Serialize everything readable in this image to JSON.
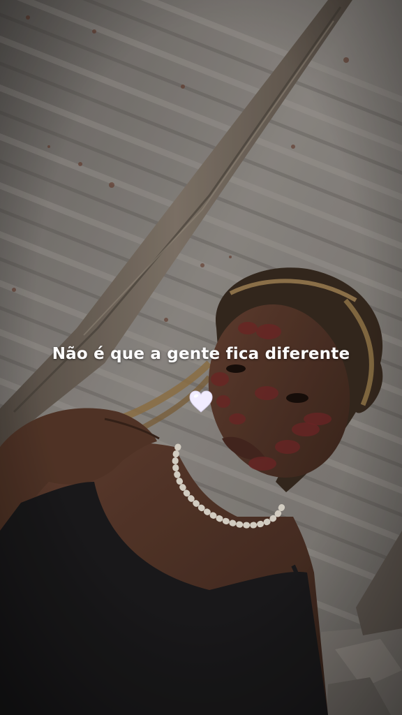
{
  "caption": {
    "text": "Não é que a gente fica diferente",
    "emoji": "white-heart"
  },
  "colors": {
    "wall": "#8f8b86",
    "wall_dark": "#5a5652",
    "wood": "#7a6e62",
    "skin": "#5b3a2c",
    "top": "#1d1c1e",
    "kiss_marks": "#7a2a2a",
    "necklace": "#efe9dc",
    "caption_text": "#ffffff",
    "heart": "#f1ecff"
  }
}
